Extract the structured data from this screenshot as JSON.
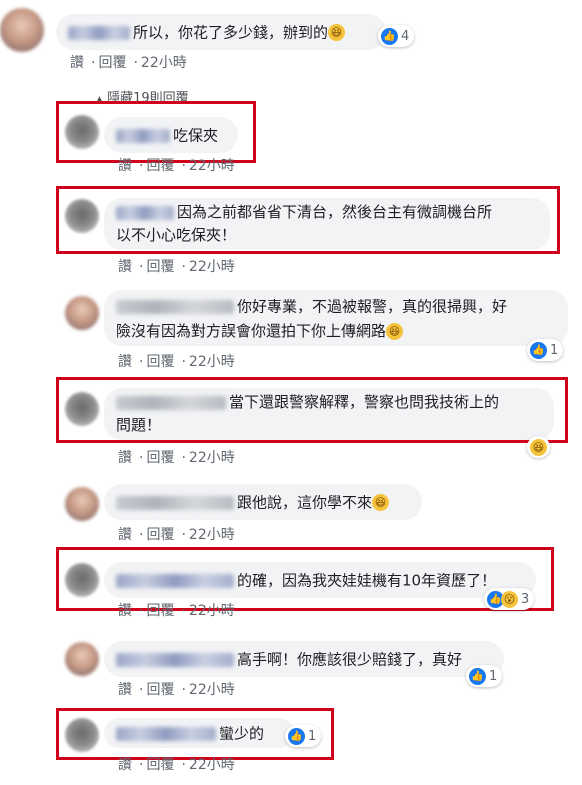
{
  "actions": {
    "like": "讚",
    "reply": "回覆",
    "dot": "·"
  },
  "hidden_replies": "隱藏19則回覆",
  "comments": [
    {
      "text": "所以，你花了多少錢，辦到的",
      "emoji": "😆",
      "time": "22小時",
      "reaction_count": "4"
    },
    {
      "text": "吃保夾",
      "time": "22小時"
    },
    {
      "text_line1": "因為之前都省省下清台，然後台主有微調機台所",
      "text_line2": "以不小心吃保夾！",
      "time": "22小時"
    },
    {
      "text_line1": "你好專業，不過被報警，真的很掃興，好",
      "text_line2": "險沒有因為對方誤會你還拍下你上傳網路",
      "emoji": "😆",
      "time": "22小時",
      "reaction_count": "1"
    },
    {
      "text_line1": "當下還跟警察解釋，警察也問我技術上的",
      "text_line2": "問題！",
      "time": "22小時"
    },
    {
      "text": "跟他說，這你學不來",
      "emoji": "😆",
      "time": "22小時"
    },
    {
      "text": "的確，因為我夾娃娃機有10年資歷了！",
      "time": "22小時",
      "reaction_count": "3"
    },
    {
      "text": "高手啊！你應該很少賠錢了，真好",
      "time": "22小時",
      "reaction_count": "1"
    },
    {
      "text": "蠻少的",
      "time": "22小時",
      "reaction_count": "1"
    }
  ],
  "colors": {
    "highlight_box": "#d0021b",
    "like_blue": "#1877f2",
    "bubble_bg": "#f2f3f5",
    "meta_text": "#606770"
  },
  "icons": [
    "like-icon",
    "haha-icon",
    "wow-icon",
    "collapse-arrow-icon"
  ]
}
